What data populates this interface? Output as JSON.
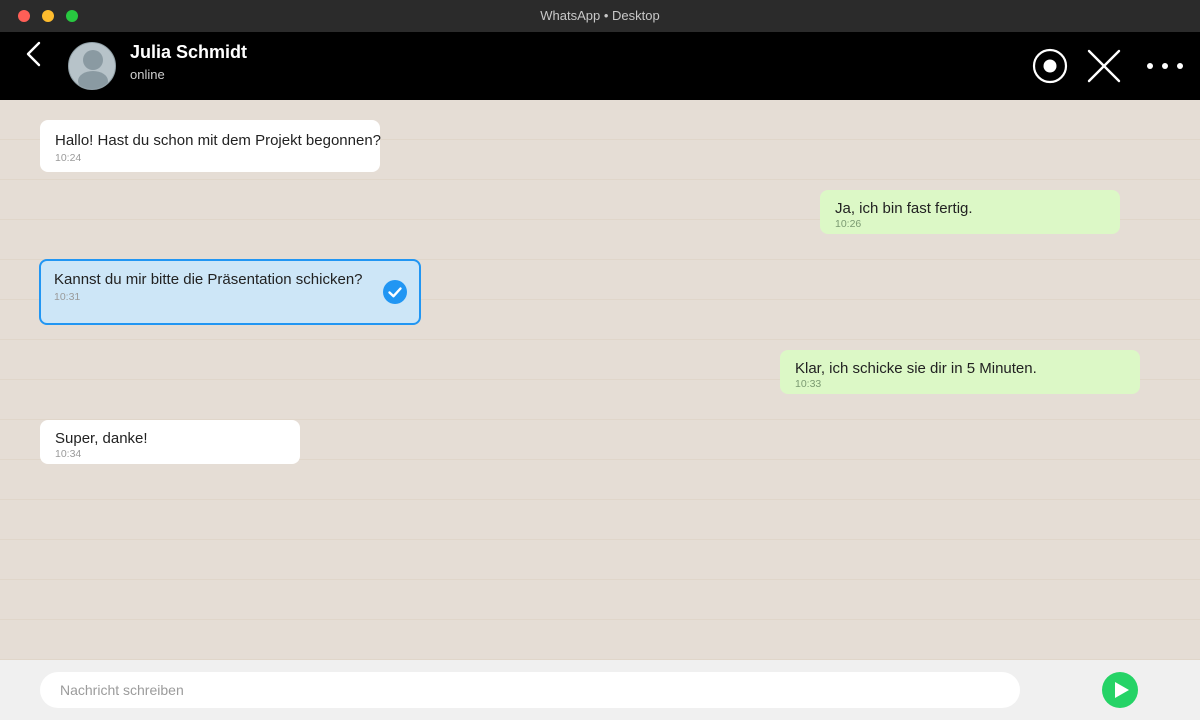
{
  "window": {
    "title": "WhatsApp • Desktop"
  },
  "header": {
    "contact_name": "Julia Schmidt",
    "status": "online",
    "icons": {
      "back": "chevron-left-icon",
      "avatar": "user-avatar-icon",
      "record": "record-icon",
      "close": "close-icon",
      "more": "more-horizontal-icon"
    }
  },
  "messages": [
    {
      "direction": "incoming",
      "text": "Hallo! Hast du schon mit dem Projekt begonnen?",
      "time": "10:24",
      "selected": false
    },
    {
      "direction": "outgoing",
      "text": "Ja, ich bin fast fertig.",
      "time": "10:26",
      "selected": false
    },
    {
      "direction": "incoming",
      "text": "Kannst du mir bitte die Präsentation schicken?",
      "time": "10:31",
      "selected": true
    },
    {
      "direction": "outgoing",
      "text": "Klar, ich schicke sie dir in 5 Minuten.",
      "time": "10:33",
      "selected": false
    },
    {
      "direction": "incoming",
      "text": "Super, danke!",
      "time": "10:34",
      "selected": false
    }
  ],
  "composer": {
    "placeholder": "Nachricht schreiben",
    "value": "",
    "send_icon": "send-icon"
  },
  "colors": {
    "header_bg": "#000000",
    "chat_bg": "#e5ddd5",
    "incoming_bubble": "#ffffff",
    "outgoing_bubble": "#dcf8c6",
    "selected_bubble": "#cde6f7",
    "selection_accent": "#2196f3",
    "send_button": "#25d366"
  }
}
